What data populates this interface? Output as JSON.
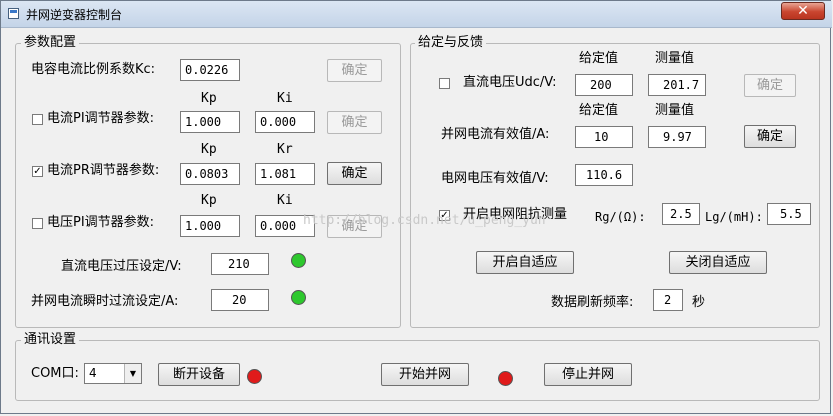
{
  "window": {
    "title": "并网逆变器控制台",
    "close_label": "✕"
  },
  "params": {
    "group_title": "参数配置",
    "kc_label": "电容电流比例系数Kc:",
    "kc_value": "0.0226",
    "kc_confirm": "确定",
    "pi_current": {
      "label": "电流PI调节器参数:",
      "h1": "Kp",
      "h2": "Ki",
      "v1": "1.000",
      "v2": "0.000",
      "checked": false,
      "confirm": "确定"
    },
    "pr_current": {
      "label": "电流PR调节器参数:",
      "h1": "Kp",
      "h2": "Kr",
      "v1": "0.0803",
      "v2": "1.081",
      "checked": true,
      "confirm": "确定"
    },
    "pi_voltage": {
      "label": "电压PI调节器参数:",
      "h1": "Kp",
      "h2": "Ki",
      "v1": "1.000",
      "v2": "0.000",
      "checked": false,
      "confirm": "确定"
    },
    "dc_overvolt_label": "直流电压过压设定/V:",
    "dc_overvolt_value": "210",
    "overcurrent_label": "并网电流瞬时过流设定/A:",
    "overcurrent_value": "20",
    "led_color": "#2ec82e"
  },
  "feedback": {
    "group_title": "给定与反馈",
    "set_header": "给定值",
    "meas_header": "测量值",
    "udc_label": "直流电压Udc/V:",
    "udc_checked": false,
    "udc_set": "200",
    "udc_meas": "201.7",
    "udc_confirm": "确定",
    "ig_label": "并网电流有效值/A:",
    "ig_set": "10",
    "ig_meas": "9.97",
    "ig_confirm": "确定",
    "grid_v_label": "电网电压有效值/V:",
    "grid_v_value": "110.6",
    "imp_label": "开启电网阻抗测量",
    "imp_checked": true,
    "rg_label": "Rg/(Ω):",
    "rg_value": "2.5",
    "lg_label": "Lg/(mH):",
    "lg_value": "5.5",
    "adapt_on": "开启自适应",
    "adapt_off": "关闭自适应",
    "refresh_label": "数据刷新频率:",
    "refresh_value": "2",
    "refresh_unit": "秒"
  },
  "comm": {
    "group_title": "通讯设置",
    "com_label": "COM口:",
    "com_value": "4",
    "disconnect": "断开设备",
    "start": "开始并网",
    "stop": "停止并网",
    "led_color": "#e01b1b"
  },
  "watermark": "http://blog.csdn.net/u_peng_yun"
}
